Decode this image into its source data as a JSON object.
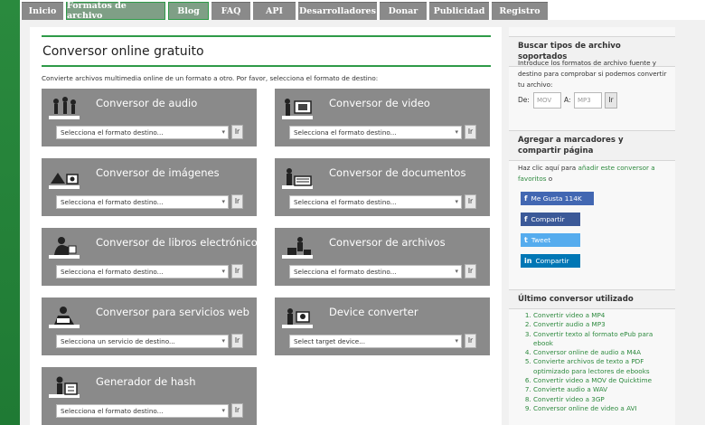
{
  "nav": {
    "tabs": [
      {
        "label": "Inicio",
        "active": false
      },
      {
        "label": "Formatos de archivo",
        "active": true
      },
      {
        "label": "Blog",
        "active": true
      },
      {
        "label": "FAQ",
        "active": false
      },
      {
        "label": "API",
        "active": false
      },
      {
        "label": "Desarrolladores",
        "active": false
      },
      {
        "label": "Donar",
        "active": false
      },
      {
        "label": "Publicidad",
        "active": false
      },
      {
        "label": "Registro",
        "active": false
      }
    ]
  },
  "main": {
    "title": "Conversor online gratuito",
    "intro": "Convierte archivos multimedia online de un formato a otro. Por favor, selecciona el formato de destino:",
    "cards": [
      {
        "title": "Conversor de audio",
        "select": "Selecciona el formato destino...",
        "go": "Ir",
        "icon": "audio-icon"
      },
      {
        "title": "Conversor de video",
        "select": "Selecciona el formato destino...",
        "go": "Ir",
        "icon": "video-icon"
      },
      {
        "title": "Conversor de imágenes",
        "select": "Selecciona el formato destino...",
        "go": "Ir",
        "icon": "image-icon"
      },
      {
        "title": "Conversor de documentos",
        "select": "Selecciona el formato destino...",
        "go": "Ir",
        "icon": "document-icon"
      },
      {
        "title": "Conversor de libros electrónicos",
        "select": "Selecciona el formato destino...",
        "go": "Ir",
        "icon": "ebook-icon"
      },
      {
        "title": "Conversor de archivos",
        "select": "Selecciona el formato destino...",
        "go": "Ir",
        "icon": "archive-icon"
      },
      {
        "title": "Conversor para servicios web",
        "select": "Selecciona un servicio de destino...",
        "go": "Ir",
        "icon": "webservice-icon"
      },
      {
        "title": "Device converter",
        "select": "Select target device...",
        "go": "Ir",
        "icon": "device-icon"
      },
      {
        "title": "Generador de hash",
        "select": "Selecciona el formato destino...",
        "go": "Ir",
        "icon": "hash-icon"
      }
    ]
  },
  "sidebar": {
    "search": {
      "heading": "Buscar tipos de archivo soportados",
      "text": "Introduce los formatos de archivo fuente y destino para comprobar si podemos convertir tu archivo:",
      "from_label": "De:",
      "from_placeholder": "MOV",
      "to_label": "A:",
      "to_placeholder": "MP3",
      "go": "Ir"
    },
    "bookmarks": {
      "heading": "Agregar a marcadores y compartir página",
      "text_prefix": "Haz clic aquí para ",
      "text_link": "añadir este conversor a favoritos",
      "text_suffix": " o",
      "social": [
        {
          "label": "Me Gusta 114K",
          "icon": "f",
          "color": "#4267b2"
        },
        {
          "label": "Compartir",
          "icon": "f",
          "color": "#3b5998"
        },
        {
          "label": "Tweet",
          "icon": "t",
          "color": "#55acee"
        },
        {
          "label": "Compartir",
          "icon": "in",
          "color": "#0077b5"
        }
      ]
    },
    "recent": {
      "heading": "Último conversor utilizado",
      "items": [
        "Convertir video a MP4",
        "Convertir audio a MP3",
        "Convertir texto al formato ePub para ebook",
        "Conversor online de audio a M4A",
        "Convierte archivos de texto a PDF optimizado para lectores de ebooks",
        "Convertir video a MOV de Quicktime",
        "Convierte audio a WAV",
        "Convertir video a 3GP",
        "Conversor online de video a AVI"
      ]
    }
  }
}
